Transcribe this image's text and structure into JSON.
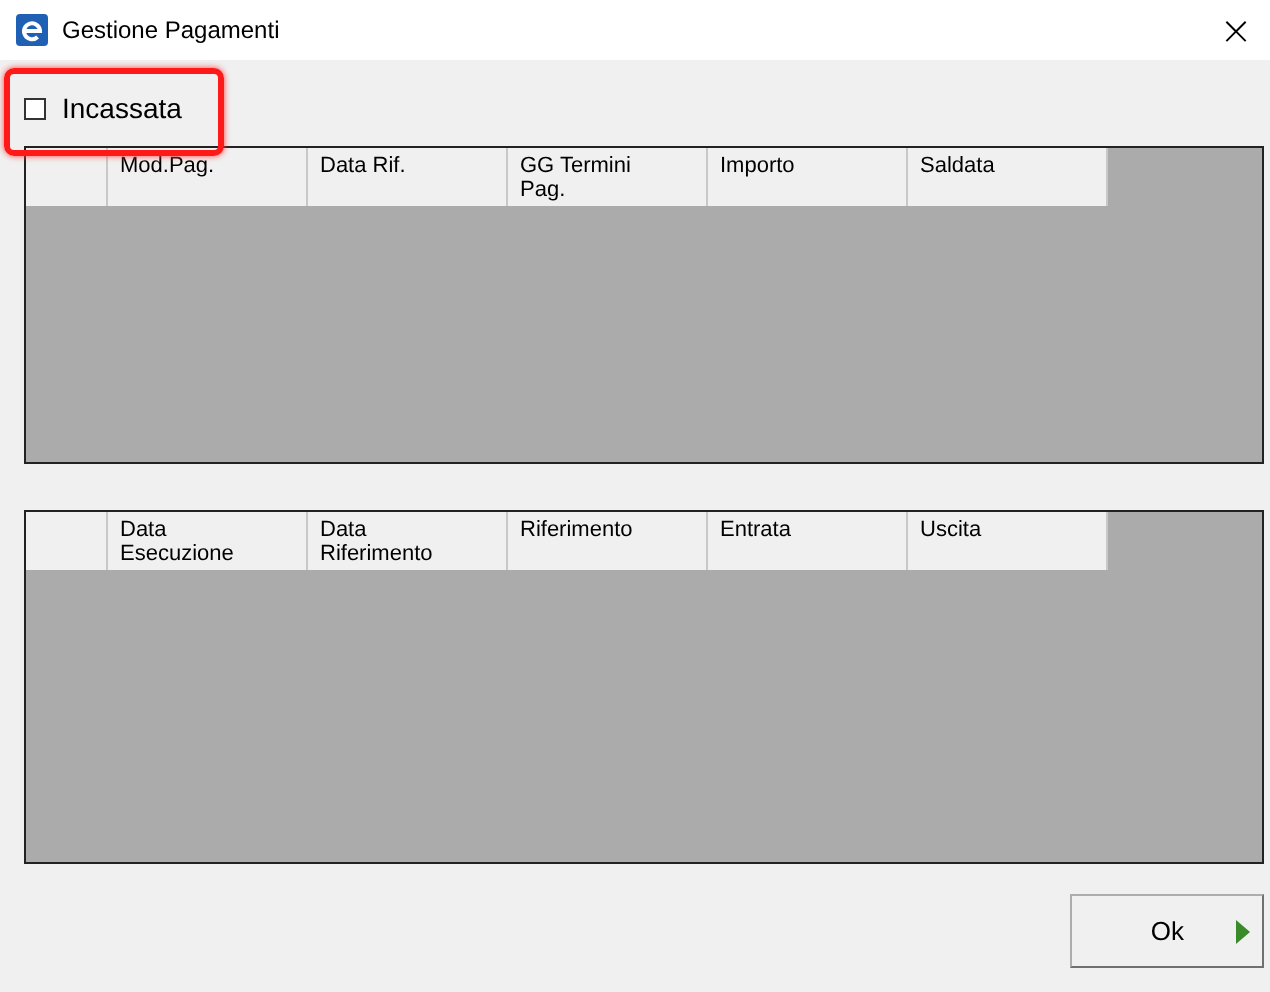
{
  "window": {
    "title": "Gestione Pagamenti",
    "close": "×"
  },
  "filter": {
    "label": "Incassata",
    "checked": false
  },
  "grids": [
    {
      "columns": [
        {
          "lines": [
            "Mod.Pag."
          ]
        },
        {
          "lines": [
            "Data Rif."
          ]
        },
        {
          "lines": [
            "GG Termini",
            "Pag."
          ]
        },
        {
          "lines": [
            "Importo"
          ]
        },
        {
          "lines": [
            "Saldata"
          ]
        }
      ]
    },
    {
      "columns": [
        {
          "lines": [
            "Data",
            "Esecuzione"
          ]
        },
        {
          "lines": [
            "Data",
            "Riferimento"
          ]
        },
        {
          "lines": [
            "Riferimento"
          ]
        },
        {
          "lines": [
            "Entrata"
          ]
        },
        {
          "lines": [
            "Uscita"
          ]
        }
      ]
    }
  ],
  "buttons": [
    {
      "label": "Ok"
    }
  ]
}
